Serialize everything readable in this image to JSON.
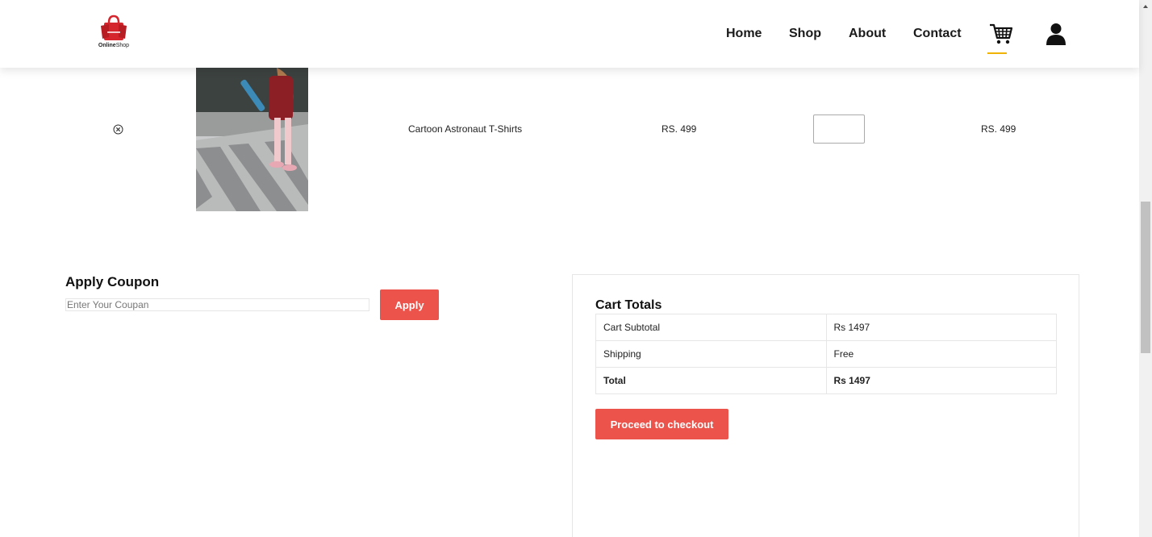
{
  "header": {
    "logo": {
      "brand_bold": "Online",
      "brand_rest": "Shop"
    },
    "nav": [
      {
        "label": "Home"
      },
      {
        "label": "Shop"
      },
      {
        "label": "About"
      },
      {
        "label": "Contact"
      }
    ],
    "icons": {
      "cart": "cart-icon",
      "user": "user-icon"
    },
    "active_indicator_color": "#f0b400"
  },
  "cart": {
    "items": [
      {
        "name": "Cartoon Astronaut T-Shirts",
        "price": "RS. 499",
        "quantity": "",
        "subtotal": "RS. 499"
      }
    ]
  },
  "coupon": {
    "title": "Apply Coupon",
    "placeholder": "Enter Your Coupan",
    "button": "Apply"
  },
  "totals": {
    "title": "Cart Totals",
    "rows": [
      {
        "label": "Cart Subtotal",
        "value": "Rs 1497"
      },
      {
        "label": "Shipping",
        "value": "Free"
      },
      {
        "label": "Total",
        "value": "Rs 1497"
      }
    ],
    "checkout_button": "Proceed to checkout"
  },
  "colors": {
    "accent": "#ec534b"
  }
}
